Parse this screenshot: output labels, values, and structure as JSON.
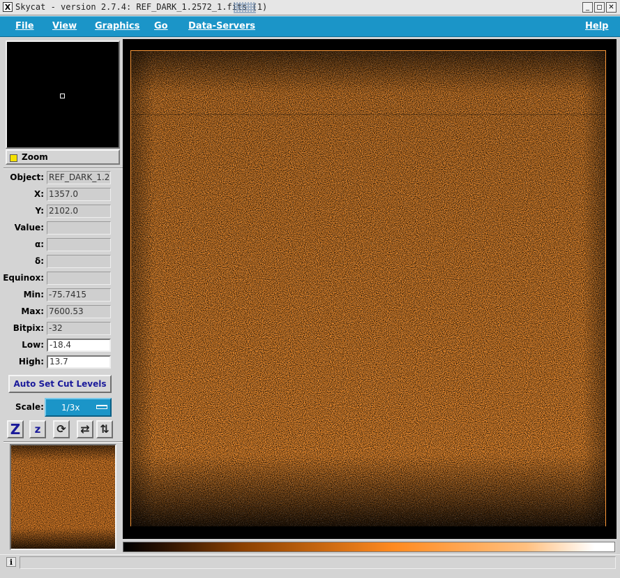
{
  "window": {
    "title": "Skycat - version 2.7.4: REF_DARK_1.2572_1.fits (1)",
    "icon_char": "X",
    "buttons": [
      "_",
      "◻",
      "✕"
    ]
  },
  "menu": {
    "items": [
      "File",
      "View",
      "Graphics",
      "Go",
      "Data-Servers"
    ],
    "help": "Help"
  },
  "zoom": {
    "label": "Zoom",
    "checkbox_color": "#f5e100"
  },
  "fields": [
    {
      "label": "Object:",
      "value": "REF_DARK_1.2",
      "editable": false
    },
    {
      "label": "X:",
      "value": "1357.0",
      "editable": false
    },
    {
      "label": "Y:",
      "value": "2102.0",
      "editable": false
    },
    {
      "label": "Value:",
      "value": "",
      "editable": false
    },
    {
      "label": "α:",
      "value": "",
      "editable": false
    },
    {
      "label": "δ:",
      "value": "",
      "editable": false
    },
    {
      "label": "Equinox:",
      "value": "",
      "editable": false
    },
    {
      "label": "Min:",
      "value": "-75.7415",
      "editable": false
    },
    {
      "label": "Max:",
      "value": "7600.53",
      "editable": false
    },
    {
      "label": "Bitpix:",
      "value": "-32",
      "editable": false
    },
    {
      "label": "Low:",
      "value": "-18.4",
      "editable": true
    },
    {
      "label": "High:",
      "value": "13.7",
      "editable": true
    }
  ],
  "buttons": {
    "auto_cut": "Auto Set Cut Levels",
    "scale_label": "Scale:",
    "scale_value": "1/3x"
  },
  "tools": [
    {
      "name": "zoom-in-button",
      "glyph": "Z",
      "icon": "zoom-in-icon"
    },
    {
      "name": "zoom-out-button",
      "glyph": "z",
      "icon": "zoom-out-icon"
    },
    {
      "name": "rotate-button",
      "glyph": "⟳",
      "icon": "rotate-icon"
    },
    {
      "name": "flip-x-button",
      "glyph": "⇄",
      "icon": "flip-x-icon"
    },
    {
      "name": "flip-y-button",
      "glyph": "⇅",
      "icon": "flip-y-icon"
    }
  ],
  "colors": {
    "menubar": "#1b95c8",
    "image_orange": "#ff8a20",
    "tool_glyph": "#1a1a9a"
  },
  "status": {
    "info_icon": "i",
    "message": ""
  }
}
